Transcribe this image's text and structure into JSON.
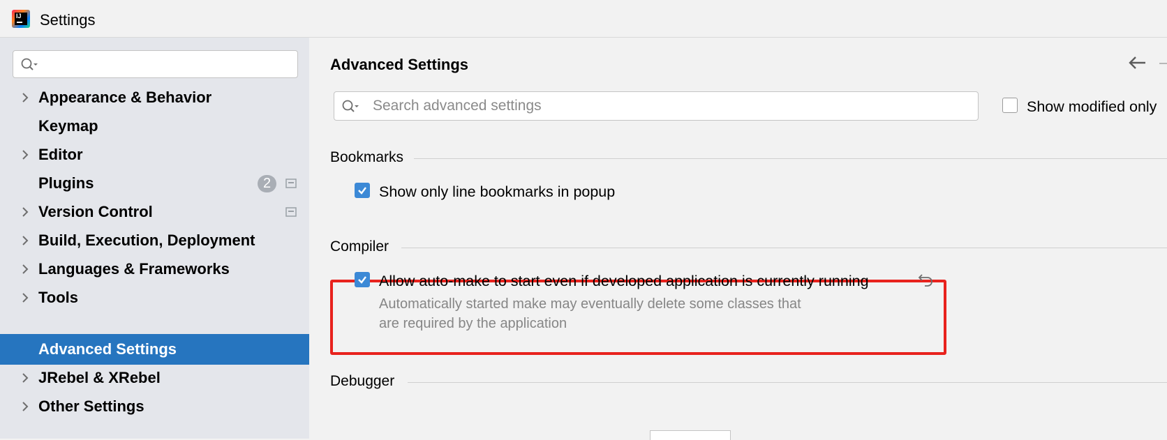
{
  "window": {
    "title": "Settings"
  },
  "sidebar": {
    "search": {
      "placeholder": ""
    },
    "items": [
      {
        "label": "Appearance & Behavior",
        "expandable": true
      },
      {
        "label": "Keymap",
        "expandable": false
      },
      {
        "label": "Editor",
        "expandable": true
      },
      {
        "label": "Plugins",
        "expandable": false,
        "badge": "2"
      },
      {
        "label": "Version Control",
        "expandable": true
      },
      {
        "label": "Build, Execution, Deployment",
        "expandable": true
      },
      {
        "label": "Languages & Frameworks",
        "expandable": true
      },
      {
        "label": "Tools",
        "expandable": true
      },
      {
        "label": "Advanced Settings",
        "expandable": false,
        "selected": true
      },
      {
        "label": "JRebel & XRebel",
        "expandable": true
      },
      {
        "label": "Other Settings",
        "expandable": true
      }
    ]
  },
  "main": {
    "title": "Advanced Settings",
    "search": {
      "placeholder": "Search advanced settings",
      "value": ""
    },
    "show_modified_only": {
      "label": "Show modified only",
      "checked": false
    },
    "sections": {
      "bookmarks": {
        "title": "Bookmarks",
        "option": {
          "label": "Show only line bookmarks in popup",
          "checked": true
        }
      },
      "compiler": {
        "title": "Compiler",
        "option": {
          "label": "Allow auto-make to start even if developed application is currently running",
          "checked": true,
          "hint_line1": "Automatically started make may eventually delete some classes that",
          "hint_line2": "are required by the application"
        }
      },
      "debugger": {
        "title": "Debugger"
      }
    }
  },
  "colors": {
    "selection": "#2675bf",
    "checkbox": "#3c89d6",
    "highlight_box": "#e8221d",
    "sidebar_bg": "#e4e6eb"
  },
  "icons": {
    "search": "search-icon",
    "chevron": "chevron-right-icon",
    "back": "back-arrow-icon",
    "reset": "reset-icon",
    "project_level": "project-level-icon"
  }
}
